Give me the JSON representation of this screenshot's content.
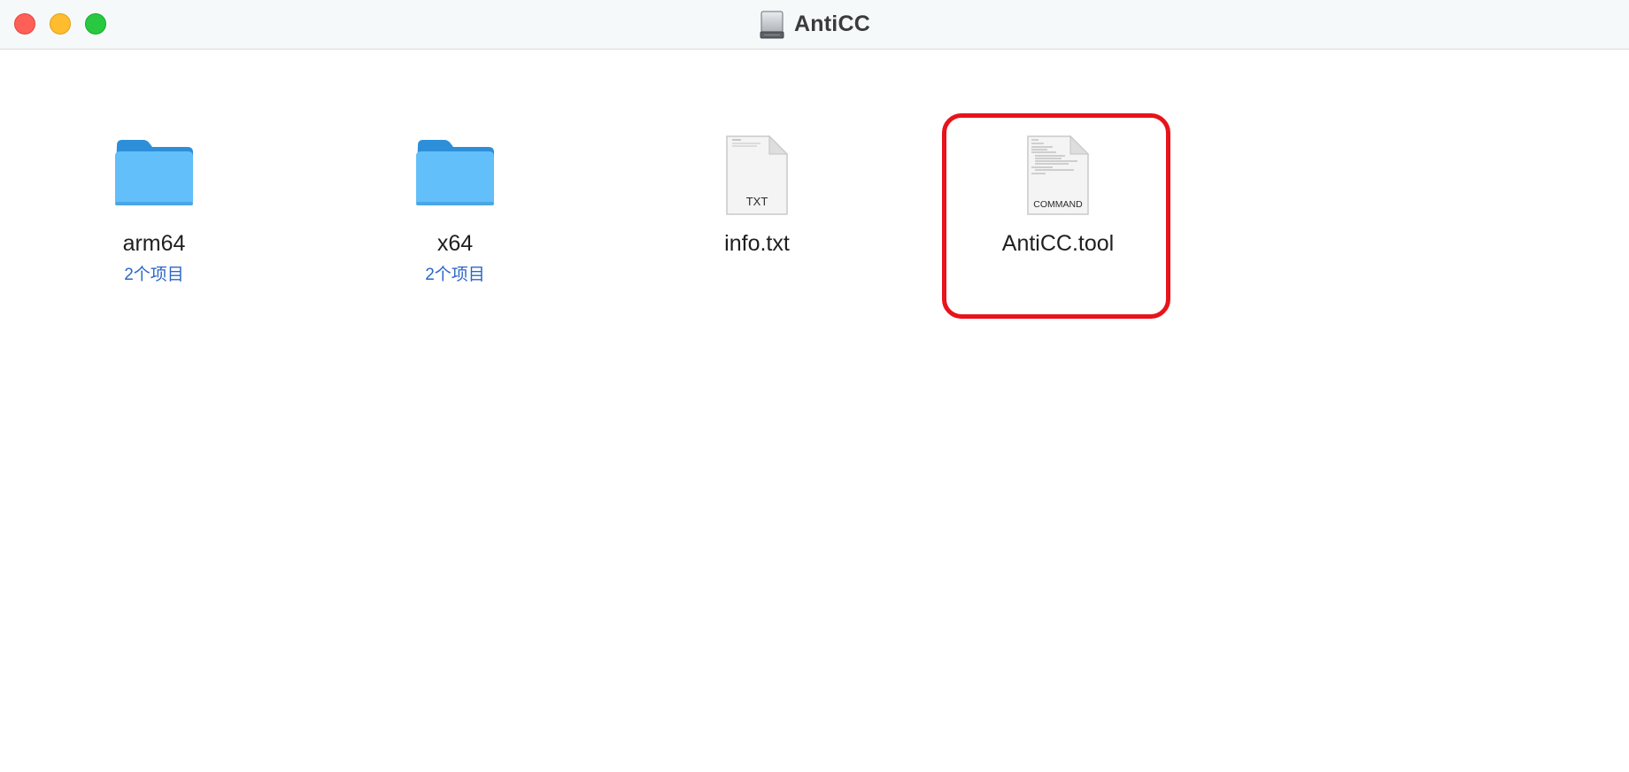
{
  "window": {
    "title": "AntiCC",
    "title_icon": "external-drive-icon"
  },
  "traffic_lights": {
    "close": "#fe5f57",
    "minimize": "#febc2e",
    "zoom": "#28c840"
  },
  "items": [
    {
      "name": "arm64",
      "subtitle": "2个项目",
      "kind": "folder",
      "icon": "folder-icon"
    },
    {
      "name": "x64",
      "subtitle": "2个项目",
      "kind": "folder",
      "icon": "folder-icon"
    },
    {
      "name": "info.txt",
      "kind": "text-document",
      "icon": "txt-document-icon",
      "badge": "TXT"
    },
    {
      "name": "AntiCC.tool",
      "kind": "command-file",
      "icon": "command-document-icon",
      "badge": "COMMAND",
      "highlighted": true
    }
  ],
  "colors": {
    "highlight": "#e8131b",
    "folder": "#5ebcf8",
    "subtitle": "#2d67c9"
  }
}
